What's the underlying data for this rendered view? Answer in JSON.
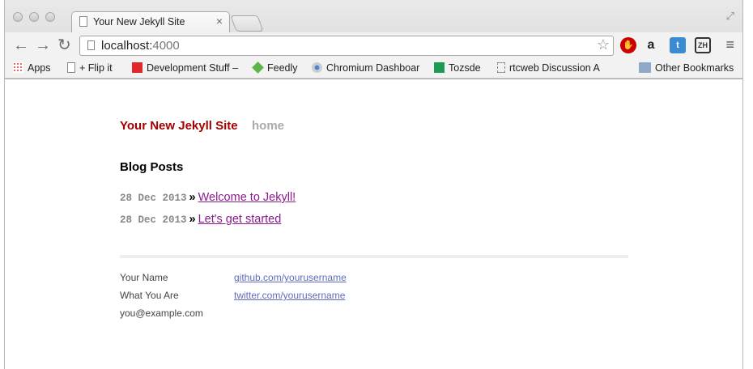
{
  "browser": {
    "tab_title": "Your New Jekyll Site",
    "url_host": "localhost:",
    "url_port": "4000",
    "bookmarks": [
      "Apps",
      "+ Flip it",
      "Development Stuff –",
      "Feedly",
      "Chromium Dashboar",
      "Tozsde",
      "rtcweb Discussion A",
      "Other Bookmarks"
    ],
    "extensions": [
      "stop-icon",
      "amazon-icon",
      "twitter-icon",
      "zh-icon"
    ]
  },
  "site": {
    "title": "Your New Jekyll Site",
    "nav_home": "home",
    "section_heading": "Blog Posts",
    "posts": [
      {
        "date": "28 Dec 2013",
        "title": "Welcome to Jekyll!"
      },
      {
        "date": "28 Dec 2013",
        "title": "Let's get started"
      }
    ],
    "footer": {
      "name": "Your Name",
      "tagline": "What You Are",
      "email": "you@example.com",
      "github": "github.com/yourusername",
      "twitter": "twitter.com/yourusername"
    }
  },
  "colors": {
    "accent": "#a50000",
    "link": "#8d1a8f",
    "footer_link": "#5e6bbf"
  }
}
